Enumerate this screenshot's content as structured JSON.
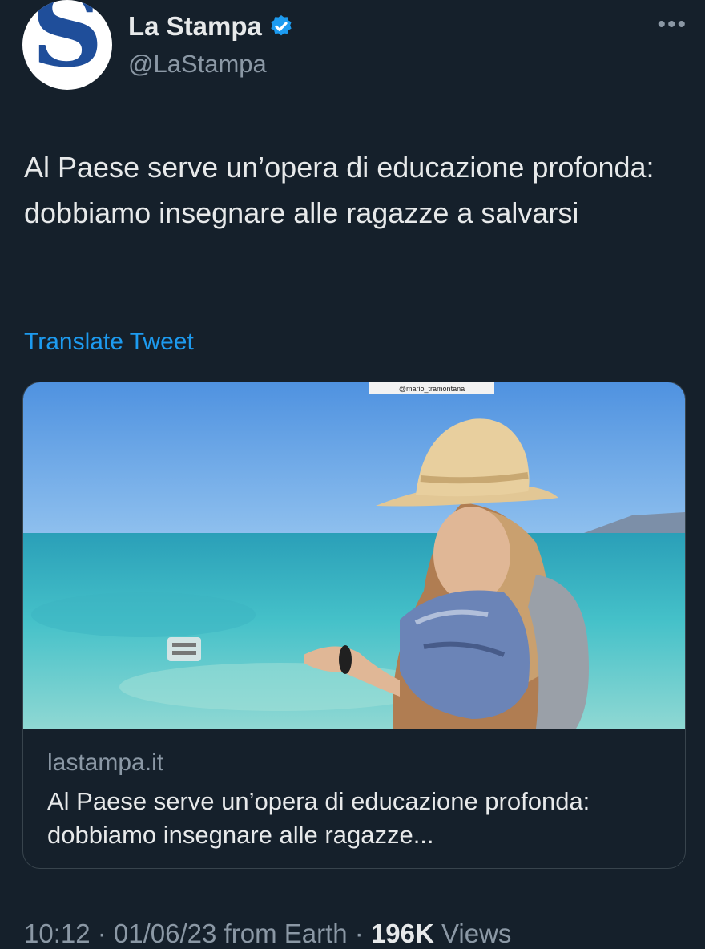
{
  "account": {
    "name": "La Stampa",
    "handle": "@LaStampa",
    "avatar_letter": "S",
    "verified": true
  },
  "more_label": "•••",
  "tweet_text": "Al Paese serve un’opera di educazione profonda: dobbiamo insegnare alle ragazze a salvarsi",
  "translate_label": "Translate Tweet",
  "card": {
    "image_watermark": "@mario_tramontana",
    "domain": "lastampa.it",
    "title": "Al Paese serve un’opera di educazione profonda: dobbiamo insegnare alle ragazze..."
  },
  "meta": {
    "time": "10:12",
    "sep1": " · ",
    "date": "01/06/23",
    "source": " from Earth",
    "sep2": " · ",
    "views_count": "196K",
    "views_label": " Views"
  },
  "colors": {
    "background": "#15202b",
    "accent": "#1d9bf0",
    "secondary_text": "#8b98a5",
    "brand": "#1f4e9a"
  }
}
